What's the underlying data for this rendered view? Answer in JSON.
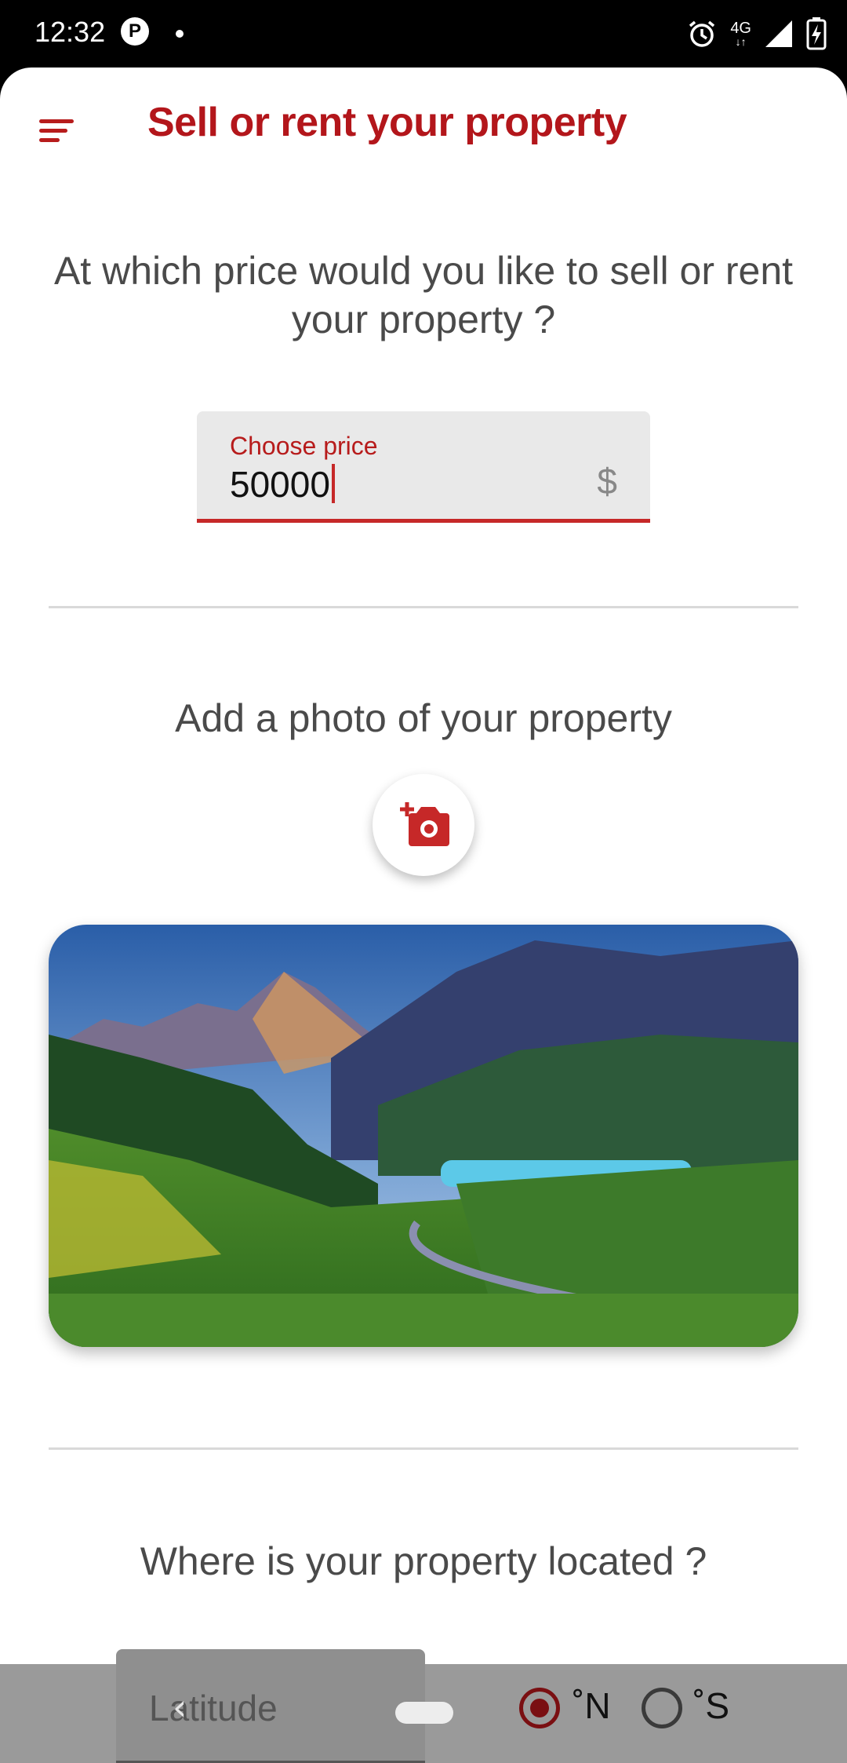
{
  "status_bar": {
    "time": "12:32",
    "network": "4G",
    "icons": [
      "p-icon",
      "notification-dot-icon",
      "alarm-icon",
      "network-4g-icon",
      "signal-icon",
      "battery-charging-icon"
    ]
  },
  "header": {
    "title": "Sell or rent your property",
    "menu_icon": "menu-icon"
  },
  "price_section": {
    "question": "At which price would you like to sell or rent your property ?",
    "field_label": "Choose price",
    "field_value": "50000",
    "suffix": "$"
  },
  "photo_section": {
    "heading": "Add a photo of your property",
    "camera_icon": "add-photo-icon"
  },
  "location_section": {
    "heading": "Where is your property located ?",
    "latitude_label": "Latitude",
    "hemisphere_options": [
      {
        "label": "˚N",
        "selected": true
      },
      {
        "label": "˚S",
        "selected": false
      }
    ]
  },
  "colors": {
    "accent": "#b3161b",
    "text": "#4a4a4a",
    "field_bg": "#e9e9e9"
  }
}
